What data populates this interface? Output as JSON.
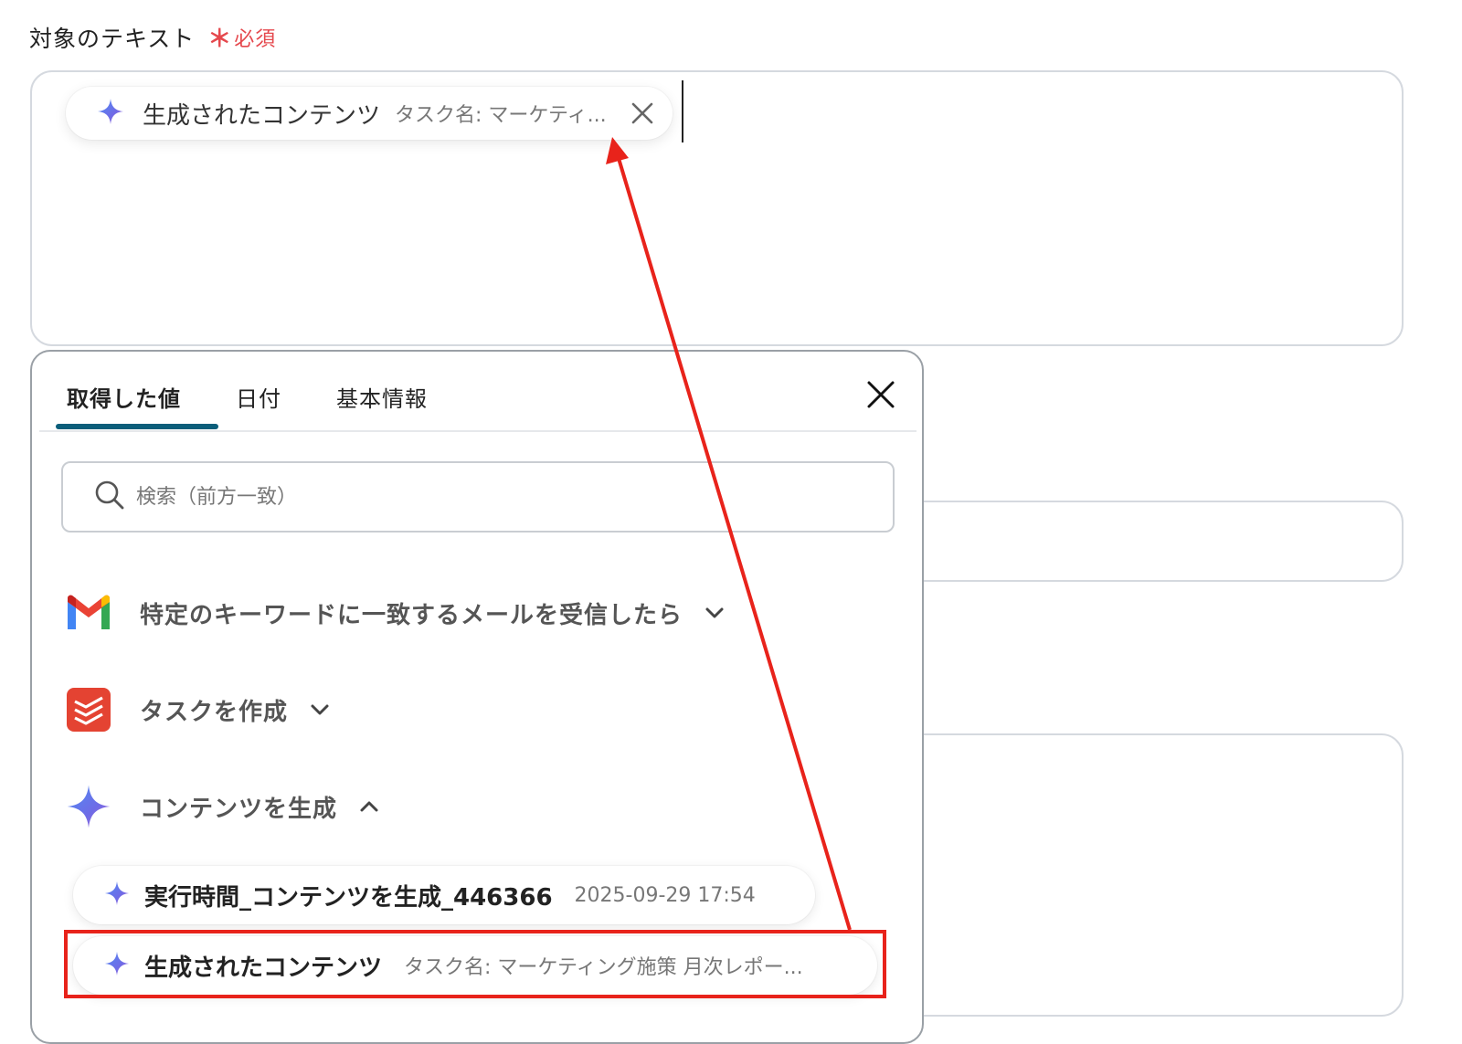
{
  "field": {
    "label": "対象のテキスト",
    "required_mark": "＊",
    "required_text": "必須"
  },
  "selected_chip": {
    "label": "生成されたコンテンツ",
    "sub": "タスク名: マーケティ...",
    "icon": "sparkle-icon"
  },
  "popup": {
    "tabs": [
      {
        "label": "取得した値",
        "active": true
      },
      {
        "label": "日付",
        "active": false
      },
      {
        "label": "基本情報",
        "active": false
      }
    ],
    "search": {
      "placeholder": "検索（前方一致）",
      "value": ""
    },
    "groups": [
      {
        "title": "特定のキーワードに一致するメールを受信したら",
        "icon": "gmail-icon",
        "expanded": false
      },
      {
        "title": "タスクを作成",
        "icon": "todoist-icon",
        "expanded": false
      },
      {
        "title": "コンテンツを生成",
        "icon": "sparkle-icon",
        "expanded": true
      }
    ],
    "items": [
      {
        "label": "実行時間_コンテンツを生成_446366",
        "sub": "2025-09-29 17:54"
      },
      {
        "label": "生成されたコンテンツ",
        "sub": "タスク名: マーケティング施策 月次レポー..."
      }
    ]
  },
  "colors": {
    "accent_tab": "#0b5e7a",
    "required": "#e5484d",
    "annotation": "#e8231b"
  }
}
